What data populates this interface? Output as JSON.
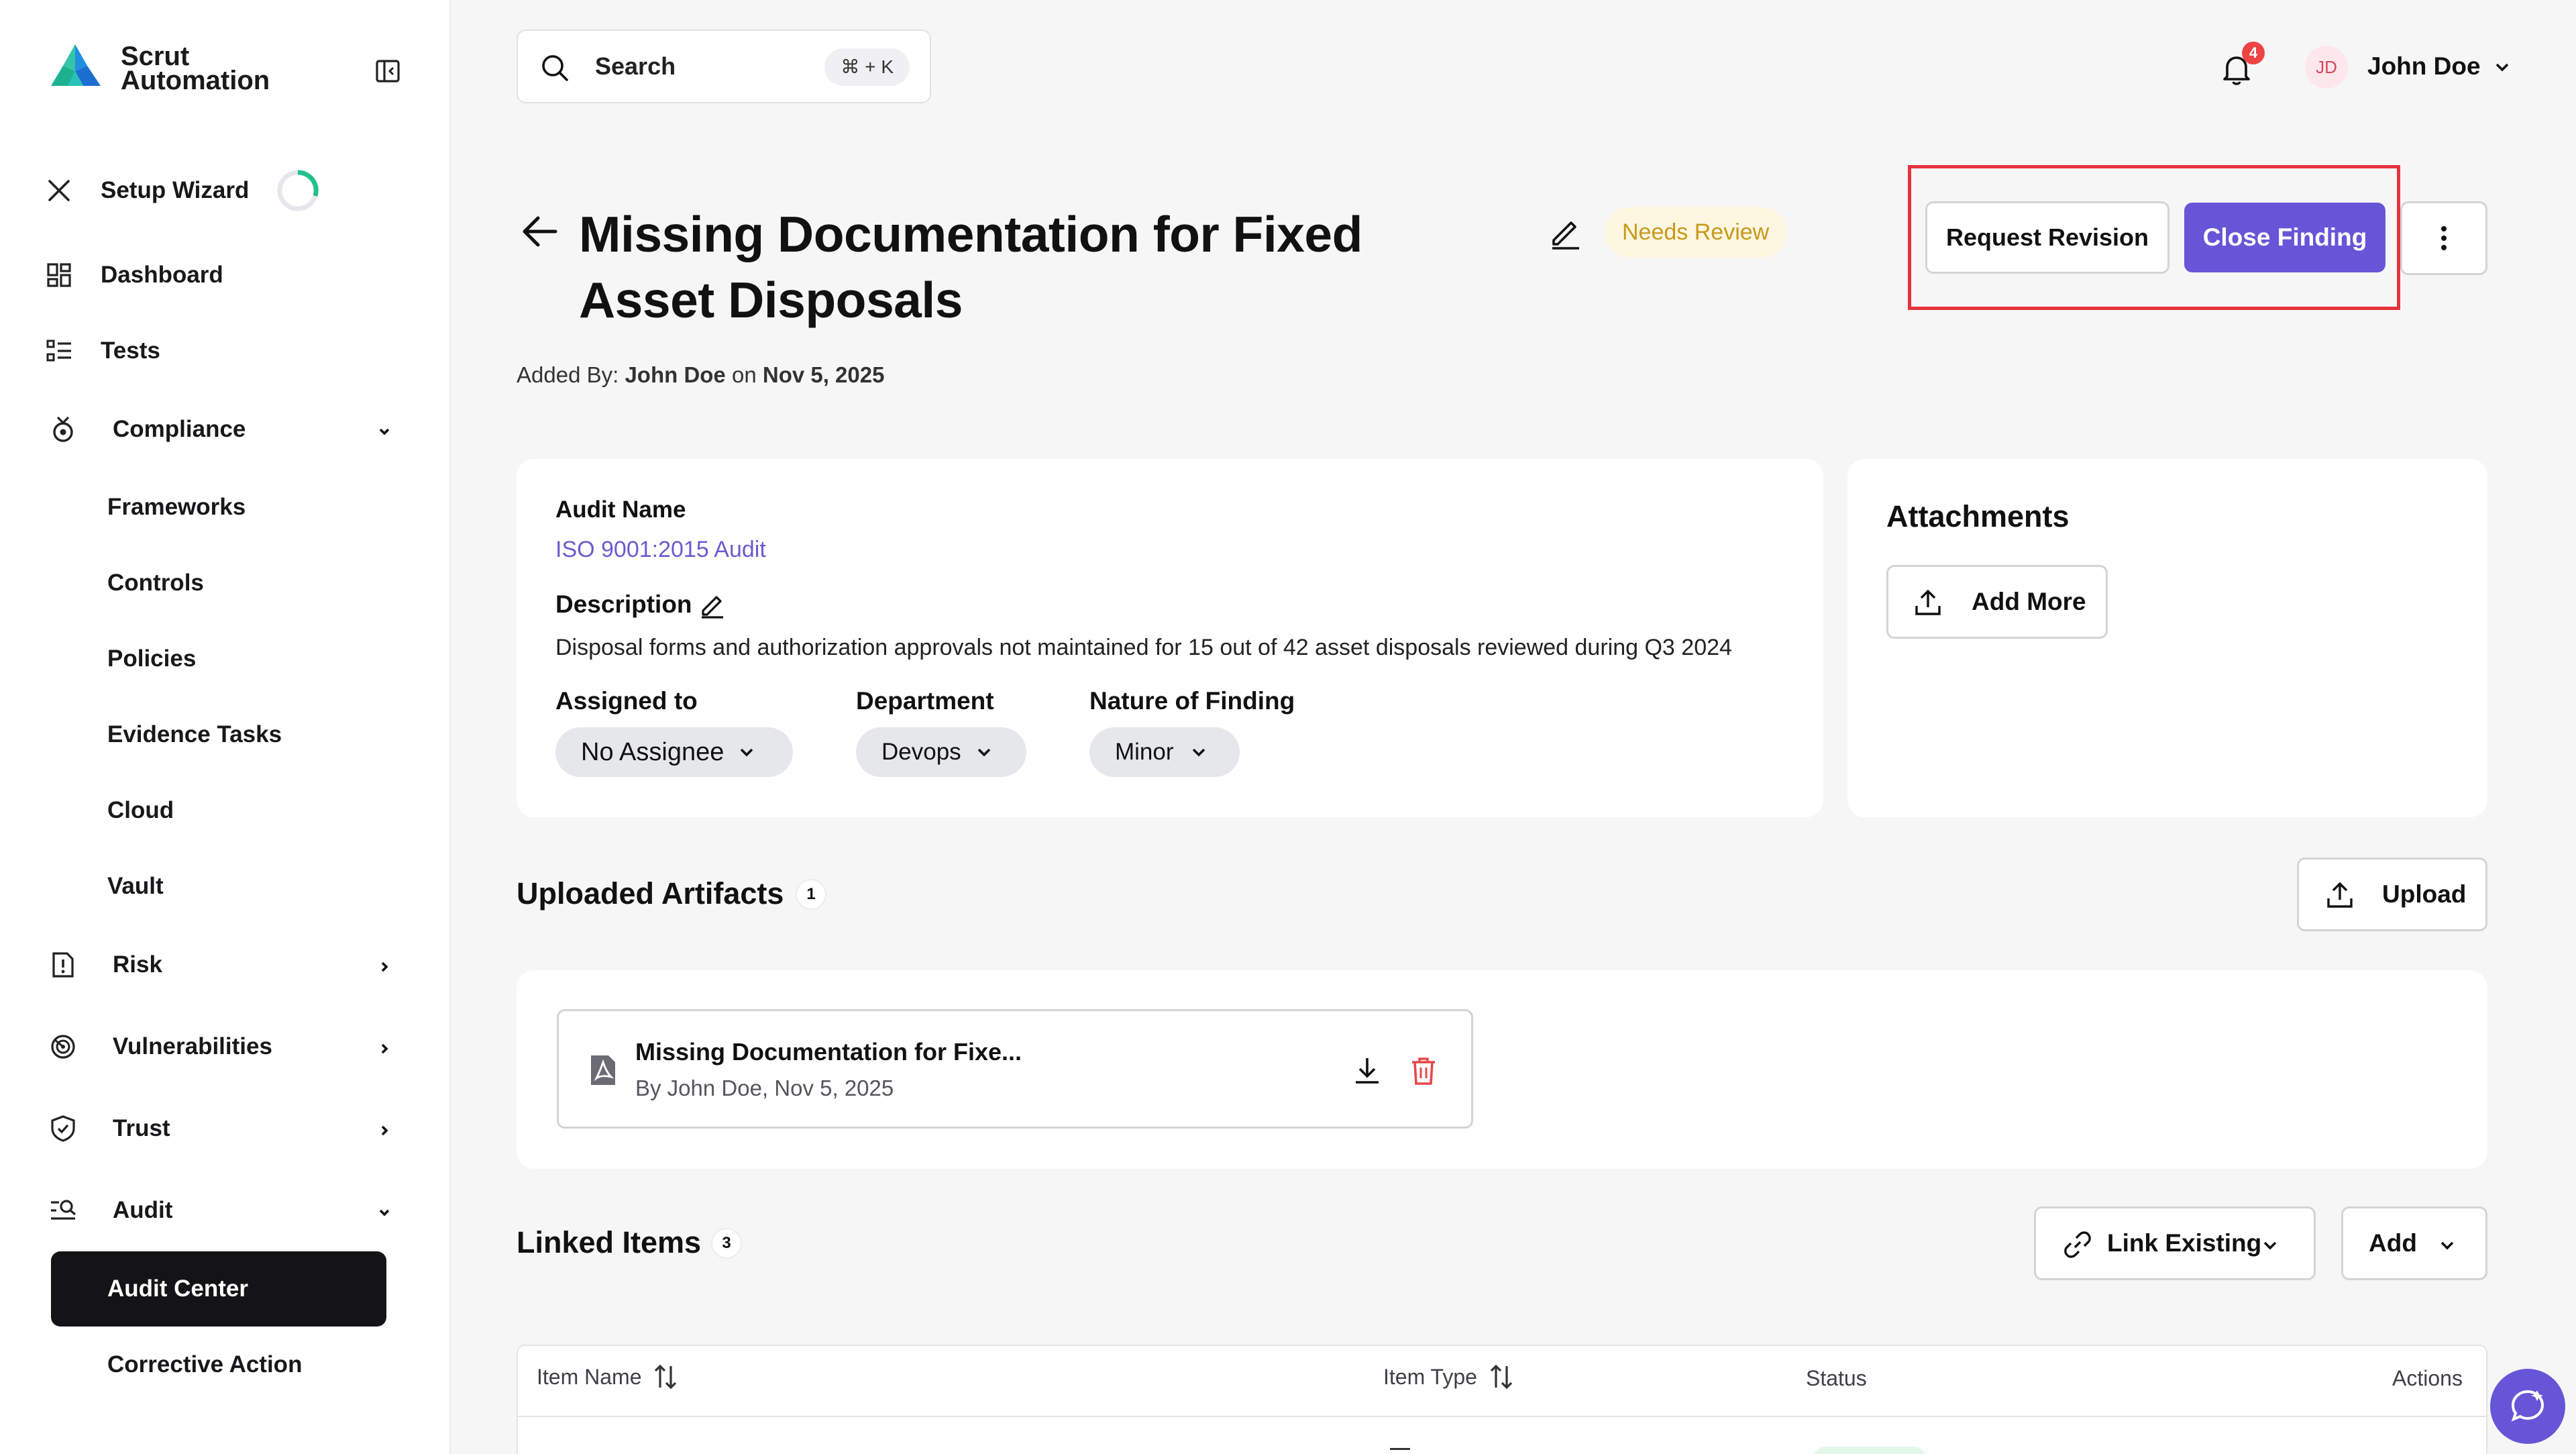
{
  "brand": {
    "line1": "Scrut",
    "line2": "Automation"
  },
  "sidebar": {
    "setup_wizard": "Setup Wizard",
    "dashboard": "Dashboard",
    "tests": "Tests",
    "compliance": "Compliance",
    "compliance_items": [
      "Frameworks",
      "Controls",
      "Policies",
      "Evidence Tasks",
      "Cloud",
      "Vault"
    ],
    "risk": "Risk",
    "vulnerabilities": "Vulnerabilities",
    "trust": "Trust",
    "audit": "Audit",
    "audit_items": [
      "Audit Center",
      "Corrective Action"
    ],
    "active_item": "Audit Center"
  },
  "topbar": {
    "search_label": "Search",
    "search_shortcut": "⌘ + K",
    "notification_count": "4",
    "user_initials": "JD",
    "user_name": "John Doe"
  },
  "finding": {
    "title": "Missing Documentation for Fixed Asset Disposals",
    "status": "Needs Review",
    "added_by_prefix": "Added By:",
    "added_by_name": "John Doe",
    "added_on_word": "on",
    "added_date": "Nov 5, 2025"
  },
  "actions": {
    "request_revision": "Request Revision",
    "close_finding": "Close Finding"
  },
  "details": {
    "audit_name_label": "Audit Name",
    "audit_name_value": "ISO 9001:2015 Audit",
    "description_label": "Description",
    "description_value": "Disposal forms and authorization approvals not maintained for 15 out of 42 asset disposals reviewed during Q3 2024",
    "assigned_label": "Assigned to",
    "assigned_value": "No Assignee",
    "department_label": "Department",
    "department_value": "Devops",
    "nature_label": "Nature of Finding",
    "nature_value": "Minor"
  },
  "attachments": {
    "title": "Attachments",
    "add_more": "Add More"
  },
  "artifacts": {
    "title": "Uploaded Artifacts",
    "count": "1",
    "upload": "Upload",
    "items": [
      {
        "name": "Missing Documentation for Fixe...",
        "meta": "By John Doe, Nov 5, 2025"
      }
    ]
  },
  "linked": {
    "title": "Linked Items",
    "count": "3",
    "link_existing": "Link Existing",
    "add": "Add",
    "columns": [
      "Item Name",
      "Item Type",
      "Status",
      "Actions"
    ]
  },
  "colors": {
    "primary": "#6755d8",
    "highlight_border": "#e5333b",
    "status_text": "#c79a1a",
    "status_bg": "#fdf6e1",
    "link": "#6a5ccf",
    "danger": "#e5484d"
  }
}
